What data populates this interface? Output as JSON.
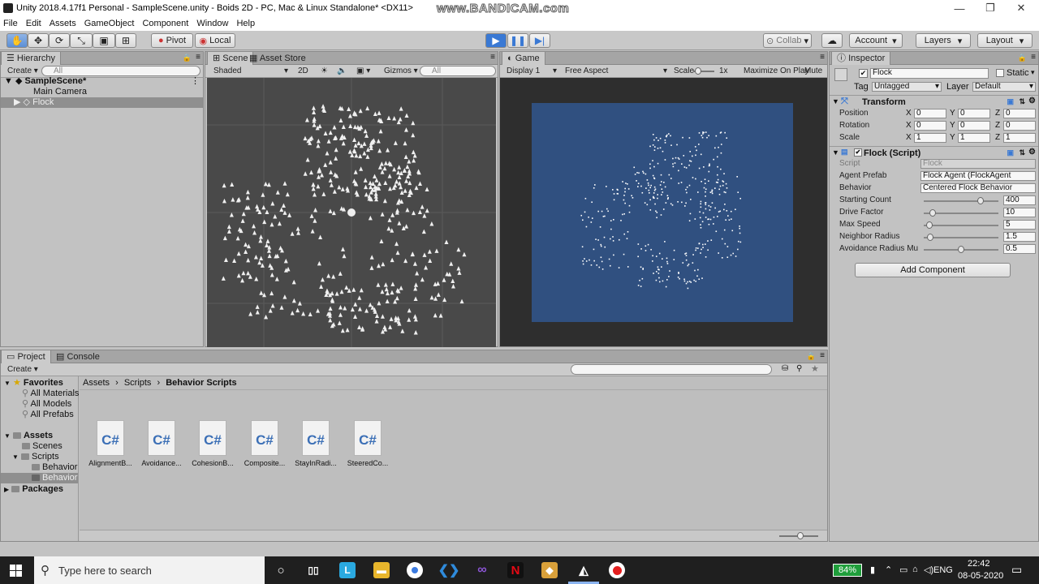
{
  "window": {
    "title": "Unity 2018.4.17f1 Personal - SampleScene.unity - Boids 2D - PC, Mac & Linux Standalone* <DX11>",
    "watermark": "www.BANDICAM.com",
    "minimize": "—",
    "maximize": "❐",
    "close": "✕"
  },
  "menu": [
    "File",
    "Edit",
    "Assets",
    "GameObject",
    "Component",
    "Window",
    "Help"
  ],
  "toolbar": {
    "pivot": "Pivot",
    "local": "Local",
    "collab": "Collab",
    "account": "Account",
    "layers": "Layers",
    "layout": "Layout"
  },
  "hierarchy": {
    "tab": "Hierarchy",
    "create": "Create",
    "search_placeholder": "All",
    "scene": "SampleScene*",
    "items": [
      "Main Camera",
      "Flock"
    ]
  },
  "scene": {
    "tab_scene": "Scene",
    "tab_asset_store": "Asset Store",
    "shading": "Shaded",
    "mode_2d": "2D",
    "gizmos": "Gizmos",
    "search_placeholder": "All"
  },
  "game": {
    "tab": "Game",
    "display": "Display 1",
    "aspect": "Free Aspect",
    "scale_label": "Scale",
    "scale_value": "1x",
    "maximize": "Maximize On Play",
    "mute": "Mute A"
  },
  "inspector": {
    "tab": "Inspector",
    "object_name": "Flock",
    "static_label": "Static",
    "tag_label": "Tag",
    "tag_value": "Untagged",
    "layer_label": "Layer",
    "layer_value": "Default",
    "transform": {
      "title": "Transform",
      "position_label": "Position",
      "rotation_label": "Rotation",
      "scale_label": "Scale",
      "x": "X",
      "y": "Y",
      "z": "Z",
      "position": [
        "0",
        "0",
        "0"
      ],
      "rotation": [
        "0",
        "0",
        "0"
      ],
      "scale": [
        "1",
        "1",
        "1"
      ]
    },
    "flock": {
      "title": "Flock (Script)",
      "script_label": "Script",
      "script_value": "Flock",
      "agent_prefab_label": "Agent Prefab",
      "agent_prefab_value": "Flock Agent (FlockAgent",
      "behavior_label": "Behavior",
      "behavior_value": "Centered Flock Behavior",
      "sliders": [
        {
          "label": "Starting Count",
          "value": "400",
          "fraction": 0.79
        },
        {
          "label": "Drive Factor",
          "value": "10",
          "fraction": 0.08
        },
        {
          "label": "Max Speed",
          "value": "5",
          "fraction": 0.04
        },
        {
          "label": "Neighbor Radius",
          "value": "1.5",
          "fraction": 0.05
        },
        {
          "label": "Avoidance Radius Mu",
          "value": "0.5",
          "fraction": 0.5
        }
      ]
    },
    "add_component": "Add Component"
  },
  "project": {
    "tab_project": "Project",
    "tab_console": "Console",
    "create": "Create",
    "breadcrumb": [
      "Assets",
      "Scripts",
      "Behavior Scripts"
    ],
    "favorites": "Favorites",
    "favorite_items": [
      "All Materials",
      "All Models",
      "All Prefabs"
    ],
    "assets": "Assets",
    "scenes": "Scenes",
    "scripts": "Scripts",
    "behavior_1": "Behavior",
    "behavior_2": "Behavior",
    "packages": "Packages",
    "files": [
      "AlignmentB...",
      "Avoidance...",
      "CohesionB...",
      "Composite...",
      "StayInRadi...",
      "SteeredCo..."
    ],
    "file_icon_text": "C#"
  },
  "taskbar": {
    "search_placeholder": "Type here to search",
    "battery": "84%",
    "language": "ENG",
    "time": "22:42",
    "date": "08-05-2020"
  }
}
